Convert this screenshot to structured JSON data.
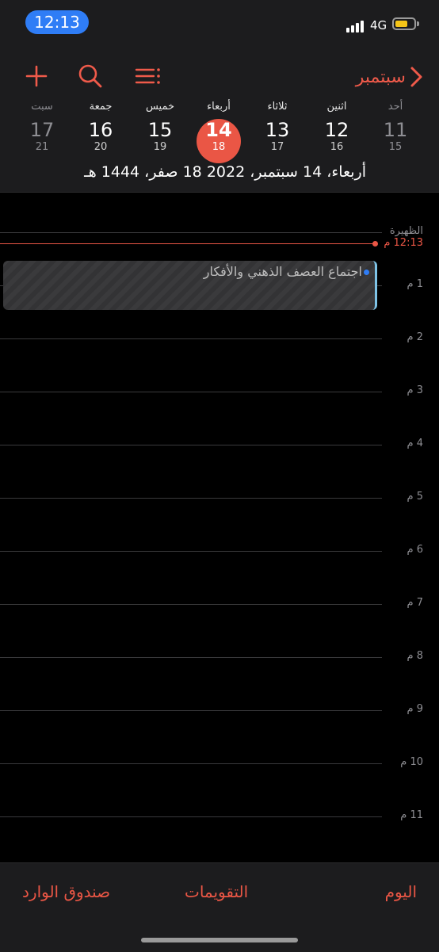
{
  "status": {
    "time": "12:13",
    "network": "4G"
  },
  "toolbar": {
    "add_icon": "plus-icon",
    "search_icon": "search-icon",
    "list_icon": "list-icon"
  },
  "nav": {
    "month": "سبتمبر"
  },
  "week": [
    {
      "name": "أحد",
      "num": "11",
      "hijri": "15"
    },
    {
      "name": "اثنين",
      "num": "12",
      "hijri": "16"
    },
    {
      "name": "ثلاثاء",
      "num": "13",
      "hijri": "17"
    },
    {
      "name": "أربعاء",
      "num": "14",
      "hijri": "18"
    },
    {
      "name": "خميس",
      "num": "15",
      "hijri": "19"
    },
    {
      "name": "جمعة",
      "num": "16",
      "hijri": "20"
    },
    {
      "name": "سبت",
      "num": "17",
      "hijri": "21"
    }
  ],
  "full_date": "أربعاء، 14 سبتمبر، 2022   18 صفر، 1444 هـ",
  "timeline": {
    "noon_label": "الظهيرة",
    "now_label": "12:13 م",
    "hours": [
      "1 م",
      "2 م",
      "3 م",
      "4 م",
      "5 م",
      "6 م",
      "7 م",
      "8 م",
      "9 م",
      "10 م",
      "11 م"
    ]
  },
  "event": {
    "title": "اجتماع العصف الذهني والأفكار"
  },
  "tabs": {
    "today": "اليوم",
    "calendars": "التقويمات",
    "inbox": "صندوق الوارد"
  },
  "colors": {
    "accent": "#ea5645",
    "event_bar": "#7ec3e6",
    "event_dot": "#2f7df6"
  }
}
